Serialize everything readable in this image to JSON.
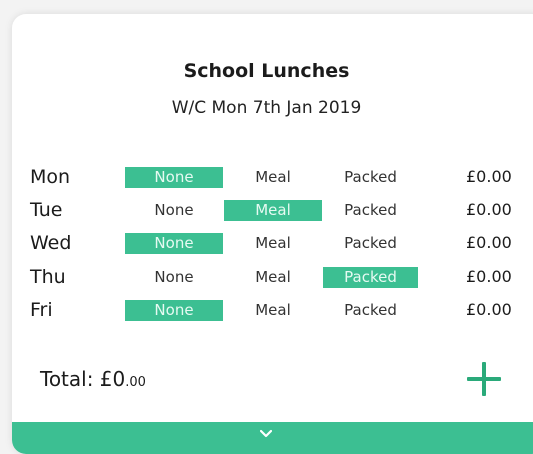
{
  "header": {
    "title": "School Lunches",
    "subtitle": "W/C Mon 7th Jan 2019"
  },
  "options": [
    "None",
    "Meal",
    "Packed"
  ],
  "days": [
    {
      "day": "Mon",
      "selected": "None",
      "price": "£0.00"
    },
    {
      "day": "Tue",
      "selected": "Meal",
      "price": "£0.00"
    },
    {
      "day": "Wed",
      "selected": "None",
      "price": "£0.00"
    },
    {
      "day": "Thu",
      "selected": "Packed",
      "price": "£0.00"
    },
    {
      "day": "Fri",
      "selected": "None",
      "price": "£0.00"
    }
  ],
  "total": {
    "label": "Total: £0",
    "pence": ".00"
  },
  "icons": {
    "add": "plus-icon",
    "expand": "chevron-down-icon"
  },
  "colors": {
    "accent": "#3cbf92",
    "plus": "#2aaa7a"
  }
}
